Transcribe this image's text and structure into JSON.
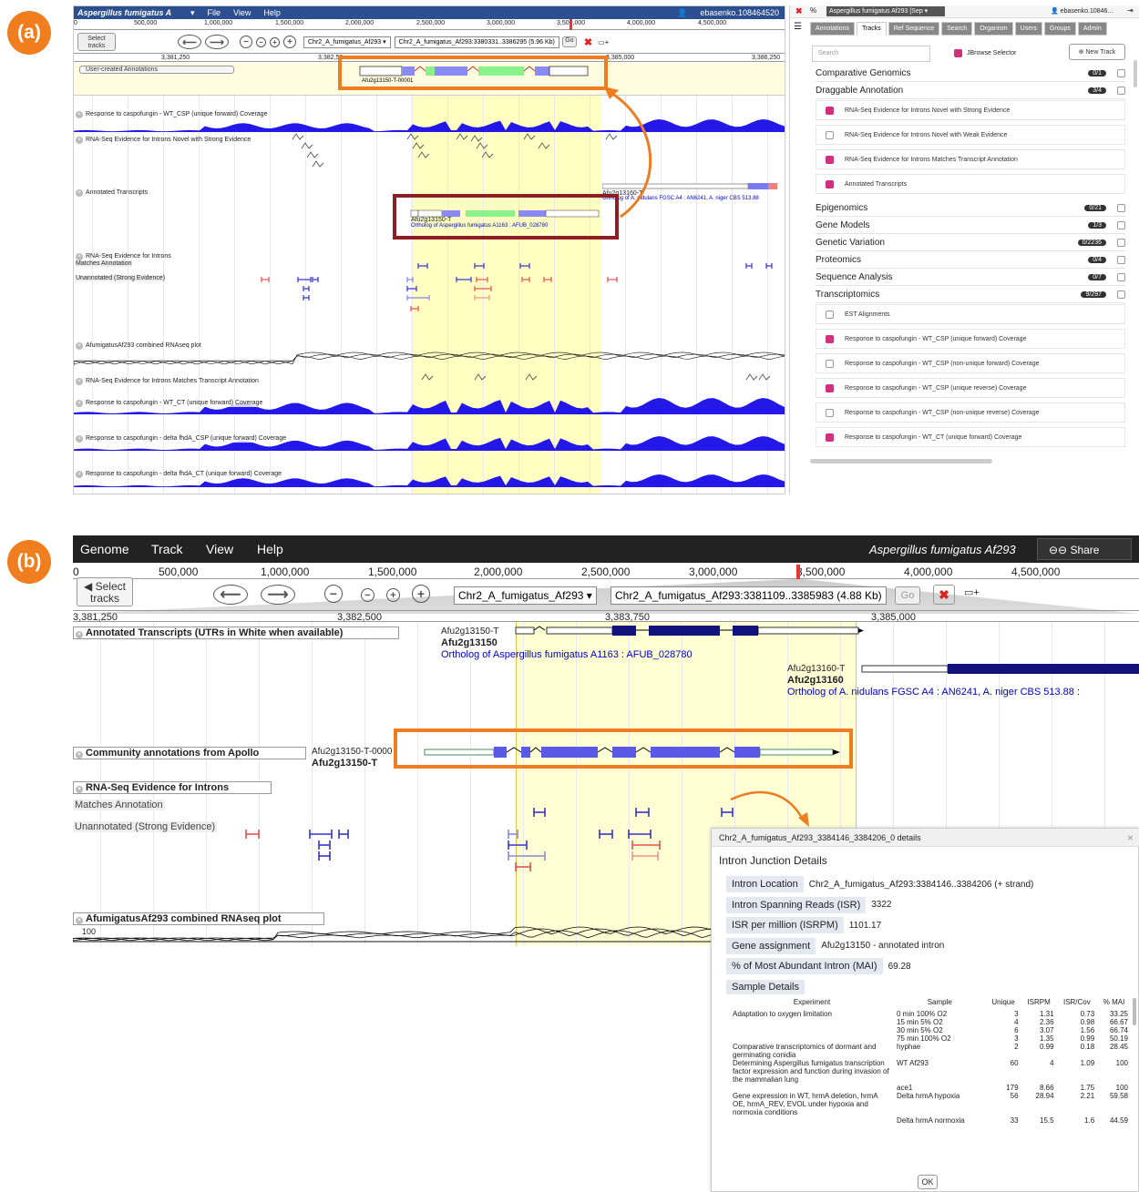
{
  "panel_labels": {
    "a": "(a)",
    "b": "(b)"
  },
  "a": {
    "menubar": {
      "title": "Aspergillus fumigatus A",
      "items": [
        "File",
        "View",
        "Help"
      ],
      "user": "ebasenko.108464520"
    },
    "ruler_ticks": [
      "0",
      "500,000",
      "1,000,000",
      "1,500,000",
      "2,000,000",
      "2,500,000",
      "3,000,000",
      "3,500,000",
      "4,000,000",
      "4,500,000"
    ],
    "select_tracks": "Select tracks",
    "refseq": "Chr2_A_fumigatus_Af293",
    "location": "Chr2_A_fumigatus_Af293:3380331..3386295 (5.96 Kb)",
    "go": "Go",
    "detail_ticks": [
      "3,381,250",
      "3,382,50",
      "3,385,000",
      "3,386,250"
    ],
    "user_created": "User-created Annotations",
    "user_feature": "Afu2g13150-T-00001",
    "tracks": [
      "Response to caspofungin - WT_CSP (unique forward) Coverage",
      "RNA-Seq Evidence for Introns Novel with Strong Evidence",
      "Annotated Transcripts",
      "RNA-Seq Evidence for Introns",
      "Matches Annotation",
      "Unannotated (Strong Evidence)",
      "AfumigatusAf293 combined RNAseq plot",
      "RNA-Seq Evidence for Introns Matches Transcript Annotation",
      "Response to caspofungin - WT_CT (unique forward) Coverage",
      "Response to caspofungin - delta fhdA_CSP (unique forward) Coverage",
      "Response to caspofungin - delta fhdA_CT (unique forward) Coverage"
    ],
    "afu13150": "Afu2g13150-T",
    "ortholog1": "Ortholog of Aspergillus fumigatus A1163 : AFUB_028780",
    "afu13160": "Afu2g13160-T",
    "ortholog2": "Ortholog of A. nidulans FGSC A4 : AN6241, A. niger CBS 513.88",
    "panel": {
      "org": "Aspergillus fumigatus Af293 [Sep",
      "user": "ebasenko.10846...",
      "tabs": [
        "Annotations",
        "Tracks",
        "Ref Sequence",
        "Search",
        "Organism",
        "Users",
        "Groups",
        "Admin"
      ],
      "search_placeholder": "Search",
      "jbrowse_selector": "JBrowse Selector",
      "new_track": "New Track",
      "categories": [
        {
          "name": "Comparative Genomics",
          "count": "0/1"
        },
        {
          "name": "Draggable Annotation",
          "count": "3/4"
        },
        {
          "name": "Epigenomics",
          "count": "0/21"
        },
        {
          "name": "Gene Models",
          "count": "1/3"
        },
        {
          "name": "Genetic Variation",
          "count": "0/2236"
        },
        {
          "name": "Proteomics",
          "count": "0/4"
        },
        {
          "name": "Sequence Analysis",
          "count": "0/7"
        },
        {
          "name": "Transcriptomics",
          "count": "9/297"
        }
      ],
      "drag_items": [
        "RNA-Seq Evidence for Introns Novel with Strong Evidence",
        "RNA-Seq Evidence for Introns Novel with Weak Evidence",
        "RNA-Seq Evidence for Introns Matches Transcript Annotation",
        "Annotated Transcripts"
      ],
      "tx_items": [
        "EST Alignments",
        "Response to caspofungin - WT_CSP (unique forward) Coverage",
        "Response to caspofungin - WT_CSP (non-unique forward) Coverage",
        "Response to caspofungin - WT_CSP (unique reverse) Coverage",
        "Response to caspofungin - WT_CSP (non-unique reverse) Coverage",
        "Response to caspofungin - WT_CT (unique forward) Coverage"
      ]
    }
  },
  "b": {
    "menu": [
      "Genome",
      "Track",
      "View",
      "Help"
    ],
    "title": "Aspergillus fumigatus Af293",
    "share": "Share",
    "ruler_ticks": [
      "0",
      "500,000",
      "1,000,000",
      "1,500,000",
      "2,000,000",
      "2,500,000",
      "3,000,000",
      "3,500,000",
      "4,000,000",
      "4,500,000"
    ],
    "select_tracks": "Select tracks",
    "refseq": "Chr2_A_fumigatus_Af293",
    "location": "Chr2_A_fumigatus_Af293:3381109..3385983 (4.88 Kb)",
    "go": "Go",
    "detail_ticks": [
      "3,381,250",
      "3,382,500",
      "3,383,750",
      "3,385,000"
    ],
    "annotated_track": "Annotated Transcripts (UTRs in White when available)",
    "t1": "Afu2g13150-T",
    "g1": "Afu2g13150",
    "o1": "Ortholog of Aspergillus fumigatus A1163 : AFUB_028780",
    "t2": "Afu2g13160-T",
    "g2": "Afu2g13160",
    "o2": "Ortholog of A. nidulans FGSC A4 : AN6241, A. niger CBS 513.88 :",
    "community_track": "Community annotations from Apollo",
    "c_t": "Afu2g13150-T-0000",
    "c_g": "Afu2g13150-T",
    "introns_track": "RNA-Seq Evidence for Introns",
    "matches": "Matches Annotation",
    "unannotated": "Unannotated (Strong Evidence)",
    "rnaseq_track": "AfumigatusAf293 combined RNAseq plot",
    "rnaseq_ymax": "100",
    "rnaseq_ymin": "0"
  },
  "dialog": {
    "title": "Chr2_A_fumigatus_Af293_3384146_3384206_0 details",
    "heading": "Intron Junction Details",
    "fields": [
      {
        "k": "Intron Location",
        "v": "Chr2_A_fumigatus_Af293:3384146..3384206 (+ strand)"
      },
      {
        "k": "Intron Spanning Reads (ISR)",
        "v": "3322"
      },
      {
        "k": "ISR per million (ISRPM)",
        "v": "1101.17"
      },
      {
        "k": "Gene assignment",
        "v": "Afu2g13150 - annotated intron"
      },
      {
        "k": "% of Most Abundant Intron (MAI)",
        "v": "69.28"
      }
    ],
    "sample_details": "Sample Details",
    "columns": [
      "Experiment",
      "Sample",
      "Unique",
      "ISRPM",
      "ISR/Cov",
      "% MAI"
    ],
    "rows": [
      [
        "Adaptation to oxygen limitation",
        "0 min 100% O2",
        "3",
        "1.31",
        "0.73",
        "33.25"
      ],
      [
        "",
        "15 min 5% O2",
        "4",
        "2.36",
        "0.98",
        "66.67"
      ],
      [
        "",
        "30 min 5% O2",
        "6",
        "3.07",
        "1.56",
        "66.74"
      ],
      [
        "",
        "75 min 100% O2",
        "3",
        "1.35",
        "0.99",
        "50.19"
      ],
      [
        "Comparative transcriptomics of dormant and germinating conidia",
        "hyphae",
        "2",
        "0.99",
        "0.18",
        "28.45"
      ],
      [
        "Determining Aspergillus fumigatus transcription factor expression and function during invasion of the mammalian lung",
        "WT Af293",
        "60",
        "4",
        "1.09",
        "100"
      ],
      [
        "",
        "ace1",
        "179",
        "8.66",
        "1.75",
        "100"
      ],
      [
        "Gene expression in WT, hrmA deletion, hrmA OE, hrmA_REV, EVOL under hypoxia and normoxia conditions",
        "Delta hrmA hypoxia",
        "56",
        "28.94",
        "2.21",
        "59.58"
      ],
      [
        "",
        "Delta hrmA normoxia",
        "33",
        "15.5",
        "1.6",
        "44.59"
      ]
    ],
    "ok": "OK"
  },
  "colors": {
    "orange": "#ee7d22",
    "darkred": "#8c1f24",
    "coverage": "#2318e8",
    "jbrowse_blue": "#2b4f91",
    "highlight": "#ffff88"
  }
}
